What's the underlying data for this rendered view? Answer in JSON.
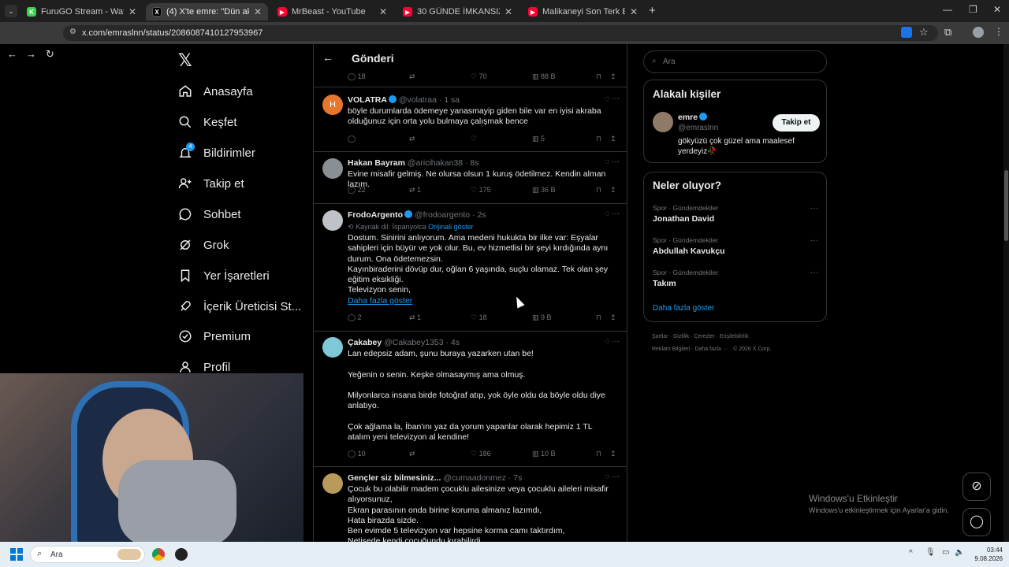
{
  "browser": {
    "tabs": [
      {
        "title": "FuruGO Stream - Watch Live on",
        "fav_color": "#39d353",
        "fav_letter": "K"
      },
      {
        "title": "(4) X'te emre: \"Dün akşam eşim",
        "fav_color": "#000000",
        "fav_letter": "X"
      },
      {
        "title": "MrBeast - YouTube",
        "fav_color": "#ff0033",
        "fav_letter": "▶"
      },
      {
        "title": "30 GÜNDE İMKANSIZI BAŞARM",
        "fav_color": "#ff0033",
        "fav_letter": "▶"
      },
      {
        "title": "Malikaneyi Son Terk Eden Kazan",
        "fav_color": "#ff0033",
        "fav_letter": "▶"
      }
    ],
    "url": "x.com/emraslnn/status/2086087410127953967"
  },
  "nav": {
    "items": [
      {
        "label": "Anasayfa",
        "icon": "home-icon"
      },
      {
        "label": "Keşfet",
        "icon": "search-icon"
      },
      {
        "label": "Bildirimler",
        "icon": "bell-icon",
        "badge": "4"
      },
      {
        "label": "Takip et",
        "icon": "follow-icon"
      },
      {
        "label": "Sohbet",
        "icon": "chat-icon"
      },
      {
        "label": "Grok",
        "icon": "grok-icon"
      },
      {
        "label": "Yer İşaretleri",
        "icon": "bookmark-icon"
      },
      {
        "label": "İçerik Üreticisi St...",
        "icon": "rocket-icon"
      },
      {
        "label": "Premium",
        "icon": "premium-icon"
      },
      {
        "label": "Profil",
        "icon": "profile-icon"
      }
    ]
  },
  "header": {
    "title": "Gönderi"
  },
  "first_actions": {
    "replies": "18",
    "likes": "70",
    "views": "88 B"
  },
  "tweets": [
    {
      "name": "VOLATRA",
      "handle": "@volatraa · 1 sa",
      "text": "böyle durumlarda ödemeye yanasmayip giden bile var en iyisi akraba olduğunuz için orta yolu bulmaya çalışmak bence",
      "replies": "",
      "retweets": "",
      "likes": "",
      "views": "5",
      "avatar_color": "#e8772e",
      "avatar_letter": "H"
    },
    {
      "name": "Hakan Bayram",
      "handle": "@aricihakan38 · 8s",
      "text": "Evine misafir gelmiş. Ne olursa olsun 1 kuruş ödetilmez. Kendin alman lazım.",
      "replies": "22",
      "retweets": "1",
      "likes": "175",
      "views": "36 B",
      "avatar_color": "#8a8f96",
      "avatar_letter": ""
    },
    {
      "name": "FrodoArgento",
      "handle": "@frodoargento · 2s",
      "translate_note": "Kaynak dil: İspanyolca",
      "translate_link": "Orijinali göster",
      "text": "Dostum. Sinirini anlıyorum. Ama medeni hukukta bir ilke var: Eşyalar sahipleri için büyür ve yok olur. Bu, ev hizmetlisi bir şeyi kırdığında aynı durum. Ona ödetemezsin.\nKayınbiraderini dövüp dur, oğlan 6 yaşında, suçlu olamaz. Tek olan şey eğitim eksikliği.\nTelevizyon senin,",
      "show_more": "Daha fazla göster",
      "replies": "2",
      "retweets": "1",
      "likes": "18",
      "views": "9 B",
      "avatar_color": "#bfc3c7",
      "avatar_letter": ""
    },
    {
      "name": "Çakabey",
      "handle": "@Cakabey1353 · 4s",
      "text": "Lan edepsiz adam, şunu buraya yazarken utan be!\n\nYeğenin o senin. Keşke olmasaymış ama olmuş.\n\nMilyonlarca insana birde fotoğraf atıp, yok öyle oldu da böyle oldu diye anlatıyo.\n\nÇok ağlama la, İban'ını yaz da yorum yapanlar olarak hepimiz 1 TL atalım yeni televizyon al kendine!",
      "replies": "10",
      "retweets": "",
      "likes": "186",
      "views": "10 B",
      "avatar_color": "#7fc8d8",
      "avatar_letter": ""
    },
    {
      "name": "Gençler siz bilmesiniz...",
      "handle": "@cumaadonmez · 7s",
      "text": "Çocuk bu olabilir madem çocuklu ailesinize veya çocuklu aileleri misafir alıyorsunuz,\nEkran parasının onda birine koruma almanız lazımdı,\nHata birazda sizde.\nBen evimde 5 televizyon var hepsine korma camı taktırdım,\nNetisede kendi cocuğundu kırabilirdi",
      "avatar_color": "#b89a5a",
      "avatar_letter": ""
    }
  ],
  "right": {
    "search_placeholder": "Ara",
    "related_title": "Alakalı kişiler",
    "person": {
      "name": "emre",
      "handle": "@emraslnn",
      "bio": "gökyüzü çok güzel ama maalesef yerdeyiz🥀",
      "follow": "Takip et"
    },
    "trends_title": "Neler oluyor?",
    "trends": [
      {
        "context": "Spor · Gündemdekiler",
        "topic": "Jonathan David"
      },
      {
        "context": "Spor · Gündemdekiler",
        "topic": "Abdullah Kavukçu"
      },
      {
        "context": "Spor · Gündemdekiler",
        "topic": "Takım"
      }
    ],
    "show_more": "Daha fazla göster",
    "footer1": [
      "Şartlar",
      "Gizlilik",
      "Çerezler",
      "Erişilebilirlik"
    ],
    "footer2": [
      "Reklam Bilgileri",
      "Daha fazla ···",
      "© 2026 X Corp."
    ]
  },
  "watermark": {
    "line1": "Windows'u Etkinleştir",
    "line2": "Windows'u etkinleştirmek için Ayarlar'a gidin."
  },
  "taskbar": {
    "search": "Ara",
    "time": "03:44",
    "date": "9.08.2026"
  }
}
